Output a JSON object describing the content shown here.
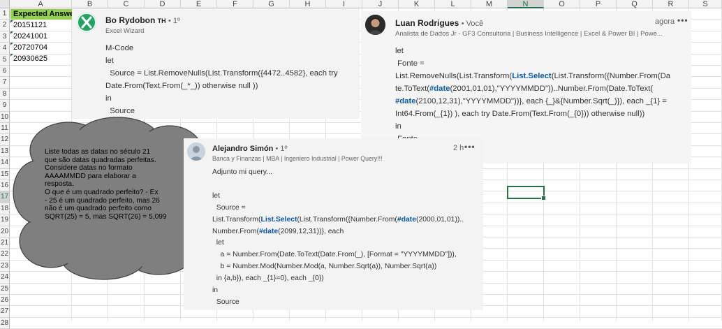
{
  "spreadsheet": {
    "columns": [
      "A",
      "B",
      "C",
      "D",
      "E",
      "F",
      "G",
      "H",
      "I",
      "J",
      "K",
      "L",
      "M",
      "N",
      "O",
      "P",
      "Q",
      "R",
      "S"
    ],
    "selected_column": "N",
    "rows": [
      "1",
      "2",
      "3",
      "4",
      "5",
      "6",
      "7",
      "8",
      "9",
      "10",
      "11",
      "12",
      "13",
      "14",
      "15",
      "16",
      "17",
      "18",
      "19",
      "20",
      "21",
      "22",
      "23",
      "24",
      "25",
      "26",
      "27",
      "28"
    ],
    "selected_row": "17",
    "column_a": {
      "header": "Expected Answer",
      "values": [
        "20151121",
        "20241001",
        "20720704",
        "20930625"
      ]
    }
  },
  "cloud_note": {
    "lines": [
      "Liste todas as datas no século 21",
      "que são datas quadradas perfeitas.",
      "Considere datas no formato",
      "AAAAMMDD para elaborar a",
      "resposta.",
      "O que é um quadrado perfeito? - Ex",
      "- 25 é um quadrado perfeito, mas 26",
      "não é um quadrado perfeito como",
      "SQRT(25) = 5, mas SQRT(26) = 5,099"
    ]
  },
  "comments": {
    "bo": {
      "name": "Bo Rydobon",
      "badge": "TH",
      "degree": "• 1º",
      "title": "Excel Wizard",
      "body": [
        "M-Code",
        "let",
        "  Source = List.RemoveNulls(List.Transform({4472..4582}, each try",
        "Date.From(Text.From(_*_)) otherwise null ))",
        "in",
        "  Source"
      ]
    },
    "luan": {
      "name": "Luan Rodrigues",
      "degree": "• Você",
      "time": "agora",
      "title": "Analista de Dados Jr - GF3 Consultoria | Business Intelligence | Excel & Power BI | Powe...",
      "body": {
        "l1": "let",
        "l2": " Fonte =",
        "l3a": "List.RemoveNulls(List.Transform(",
        "l3b": "List.Select",
        "l3c": "(List.Transform({Number.From(Da",
        "l4a": "te.ToText(",
        "l4b": "#date",
        "l4c": "(2001,01,01),\"YYYYMMDD\"))..Number.From(Date.ToText(",
        "l5a": "#date",
        "l5b": "(2100,12,31),\"YYYYMMDD\"))}, each {_}&{Number.Sqrt(_)}), each _{1} =",
        "l6": "Int64.From(_{1}) ), each try Date.From(Text.From(_{0})) otherwise null))",
        "l7": "in",
        "l8": " Fonte"
      }
    },
    "alejandro": {
      "name": "Alejandro Simón",
      "degree": "• 1º",
      "time": "2 h",
      "title": "Banca y Finanzas | MBA | Ingeniero Industrial | Power Query!!!",
      "body": {
        "l1": "Adjunto mi query...",
        "l2": "let",
        "l3": "  Source =",
        "l4a": "List.Transform(",
        "l4b": "List.Select",
        "l4c": "(List.Transform({Number.From(",
        "l4d": "#date",
        "l4e": "(2000,01,01))..",
        "l5a": "Number.From(",
        "l5b": "#date",
        "l5c": "(2099,12,31))}, each",
        "l6": "  let",
        "l7": "    a = Number.From(Date.ToText(Date.From(_), [Format = \"YYYYMMDD\"])),",
        "l8": "    b = Number.Mod(Number.Mod(a, Number.Sqrt(a)), Number.Sqrt(a))",
        "l9": "  in {a,b}), each _{1}=0), each _{0})",
        "l10": "in",
        "l11": "  Source"
      }
    }
  },
  "colors": {
    "excel_green": "#217346",
    "header_fill": "#92d050",
    "keyword_blue": "#0a58a6",
    "cloud_fill": "#7f7f7f"
  }
}
